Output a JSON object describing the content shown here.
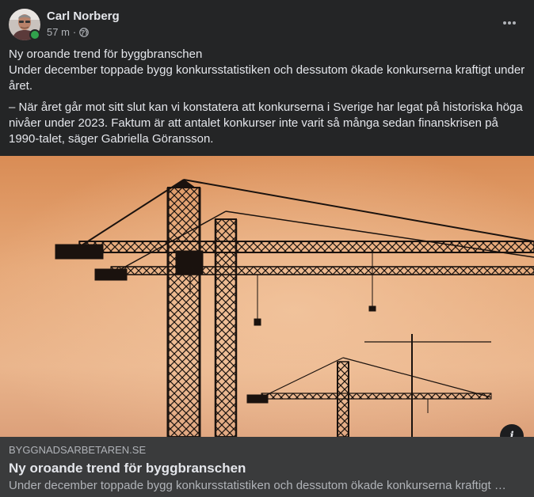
{
  "post": {
    "author": "Carl Norberg",
    "time": "57 m",
    "separator": "·",
    "audience_icon": "globe-icon",
    "more_icon": "more-options-icon",
    "text": {
      "line1": "Ny oroande trend för byggbranschen",
      "line2": "Under december toppade bygg konkursstatistiken och dessutom ökade konkurserna kraftigt under året.",
      "paragraph2": "– När året går mot sitt slut kan vi konstatera att konkurserna i Sverige har legat på historiska höga nivåer under 2023. Faktum är att antalet konkurser inte varit så många sedan finanskrisen på 1990-talet, säger Gabriella Göransson."
    }
  },
  "link_preview": {
    "domain": "BYGGNADSARBETAREN.SE",
    "title": "Ny oroande trend för byggbranschen",
    "description": "Under december toppade bygg konkursstatistiken och dessutom ökade konkurserna kraftigt under året.",
    "info_icon": "info-icon"
  },
  "colors": {
    "background": "#242526",
    "preview_background": "#3a3b3c",
    "primary_text": "#e4e6eb",
    "secondary_text": "#b0b3b8",
    "online": "#31a24c",
    "sky": "#e2a577"
  }
}
